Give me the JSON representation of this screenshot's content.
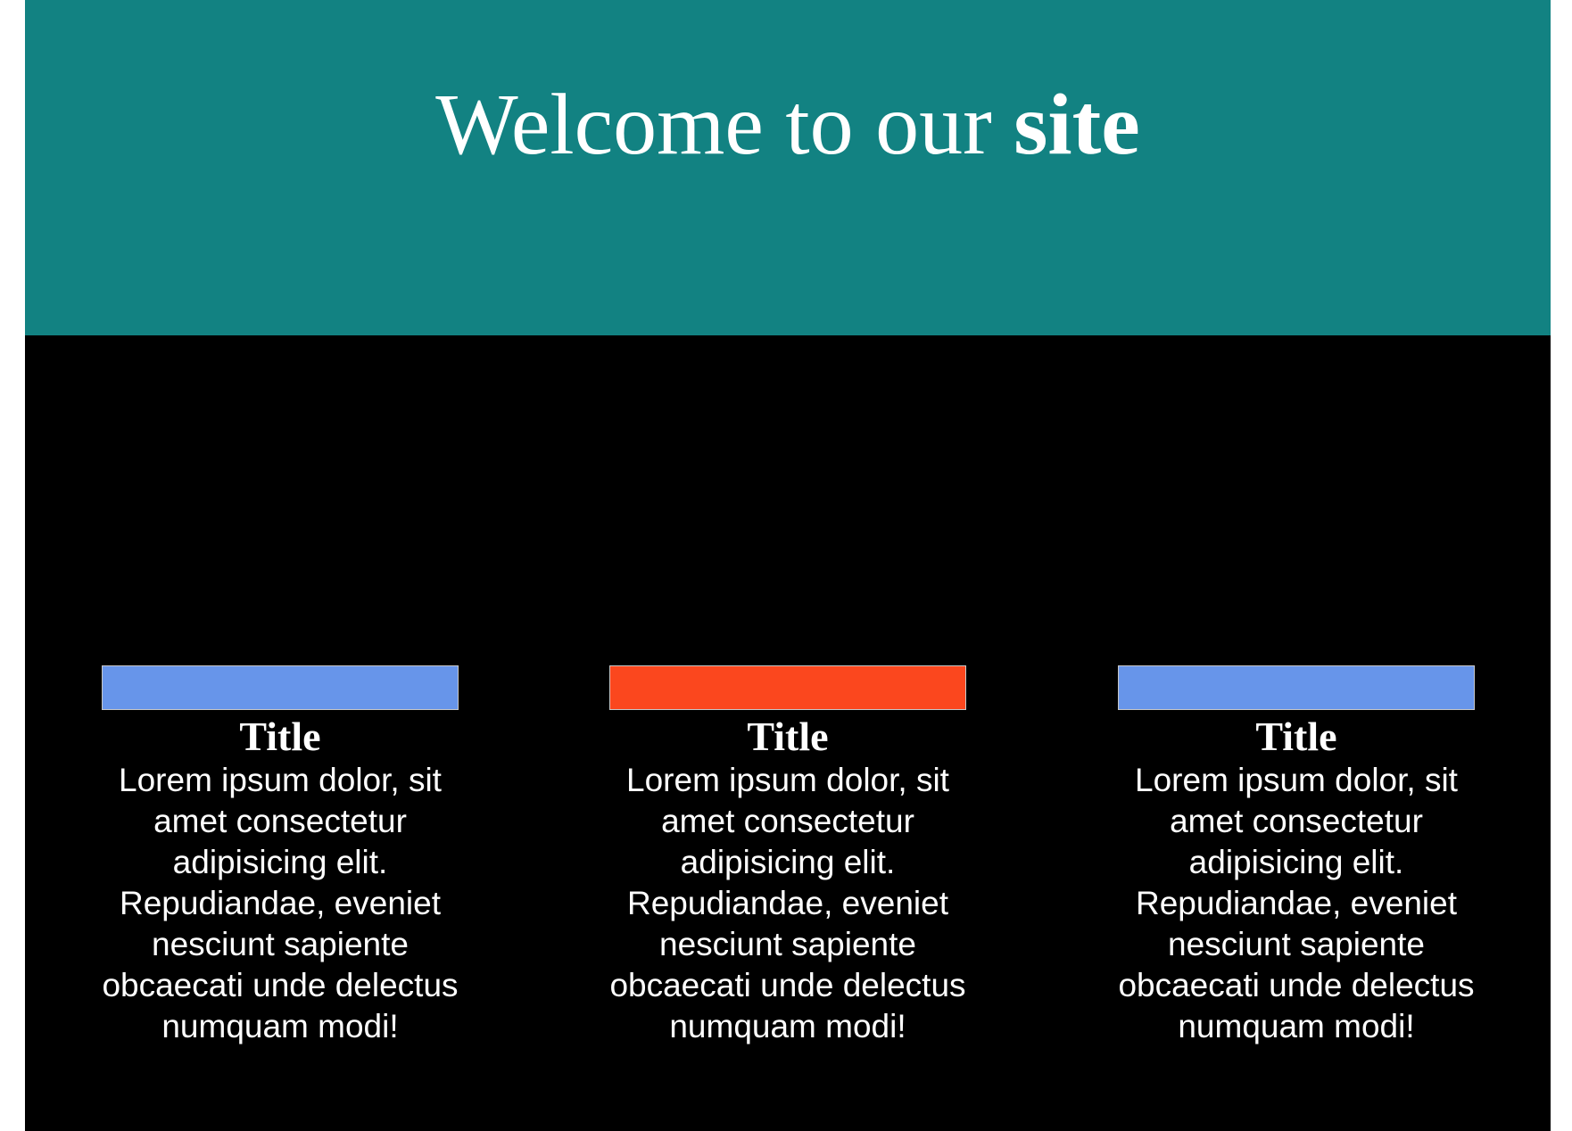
{
  "hero": {
    "title_normal": "Welcome to our ",
    "title_bold": "site",
    "background": "#128282"
  },
  "cards": [
    {
      "bar_color": "#6795ea",
      "title": "Title",
      "text": "Lorem ipsum dolor, sit amet consectetur adipisicing elit. Repudiandae, eveniet nesciunt sapiente obcaecati unde delectus numquam modi!"
    },
    {
      "bar_color": "#fb471e",
      "title": "Title",
      "text": "Lorem ipsum dolor, sit amet consectetur adipisicing elit. Repudiandae, eveniet nesciunt sapiente obcaecati unde delectus numquam modi!"
    },
    {
      "bar_color": "#6795ea",
      "title": "Title",
      "text": "Lorem ipsum dolor, sit amet consectetur adipisicing elit. Repudiandae, eveniet nesciunt sapiente obcaecati unde delectus numquam modi!"
    }
  ]
}
